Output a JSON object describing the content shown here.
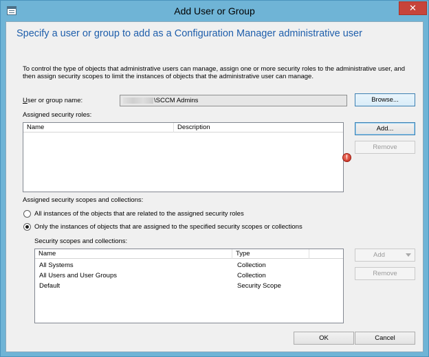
{
  "window": {
    "title": "Add User or Group",
    "close_glyph": "✕"
  },
  "heading": "Specify a user or group to add as a Configuration Manager administrative user",
  "description": "To control the type of objects that administrative users can manage, assign one or more security roles  to the  administrative user, and then assign security scopes to limit the instances of objects that the administrative user can manage.",
  "user_group": {
    "label": "User or group name:",
    "value": "\\SCCM Admins",
    "browse_label": "Browse..."
  },
  "roles": {
    "label": "Assigned security roles:",
    "columns": [
      "Name",
      "Description"
    ],
    "rows": [],
    "add_label": "Add...",
    "remove_label": "Remove"
  },
  "scopes": {
    "label": "Assigned security scopes and collections:",
    "option_all": "All instances of the objects that are related to the assigned security roles",
    "option_only": "Only the instances of objects that are assigned to the specified security scopes or collections",
    "selected": "only",
    "list_label": "Security scopes and collections:",
    "columns": [
      "Name",
      "Type"
    ],
    "rows": [
      {
        "name": "All Systems",
        "type": "Collection"
      },
      {
        "name": "All Users and User Groups",
        "type": "Collection"
      },
      {
        "name": "Default",
        "type": "Security Scope"
      }
    ],
    "add_label": "Add",
    "remove_label": "Remove"
  },
  "footer": {
    "ok_label": "OK",
    "cancel_label": "Cancel"
  },
  "icons": {
    "error": "error-icon",
    "window": "window-icon"
  },
  "colors": {
    "heading": "#1e5eab",
    "frame": "#6fb4d6",
    "close": "#c7443a",
    "error": "#c5271a"
  }
}
